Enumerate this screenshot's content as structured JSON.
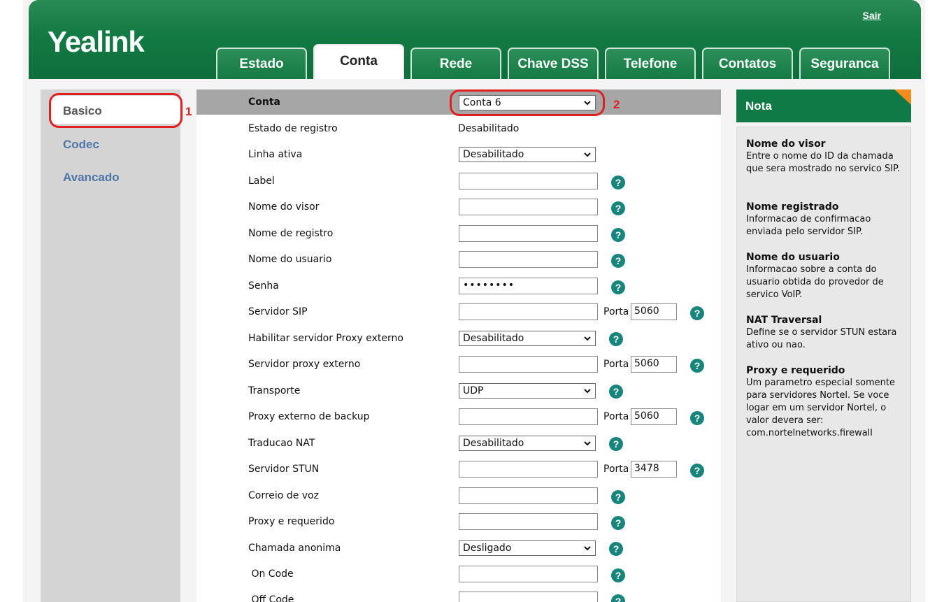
{
  "header": {
    "logo": "Yealink",
    "logout": "Sair",
    "tabs": [
      "Estado",
      "Conta",
      "Rede",
      "Chave DSS",
      "Telefone",
      "Contatos",
      "Seguranca"
    ],
    "active_tab": "Conta"
  },
  "sidebar": {
    "items": [
      "Basico",
      "Codec",
      "Avancado"
    ],
    "active": "Basico"
  },
  "annotations": [
    "1",
    "2"
  ],
  "form": {
    "account_label": "Conta",
    "account_value": "Conta 6",
    "rows": [
      {
        "label": "Estado de registro",
        "value": "Desabilitado"
      },
      {
        "label": "Linha ativa",
        "value": "Desabilitado"
      },
      {
        "label": "Label",
        "value": ""
      },
      {
        "label": "Nome do visor",
        "value": ""
      },
      {
        "label": "Nome de registro",
        "value": ""
      },
      {
        "label": "Nome do usuario",
        "value": ""
      },
      {
        "label": "Senha",
        "value": "••••••••"
      },
      {
        "label": "Servidor SIP",
        "value": "",
        "porta": "5060"
      },
      {
        "label": "Habilitar servidor Proxy externo",
        "value": "Desabilitado"
      },
      {
        "label": "Servidor proxy externo",
        "value": "",
        "porta": "5060"
      },
      {
        "label": "Transporte",
        "value": "UDP"
      },
      {
        "label": "Proxy externo de backup",
        "value": "",
        "porta": "5060"
      },
      {
        "label": "Traducao NAT",
        "value": "Desabilitado"
      },
      {
        "label": "Servidor STUN",
        "value": "",
        "porta": "3478"
      },
      {
        "label": "Correio de voz",
        "value": ""
      },
      {
        "label": "Proxy e requerido",
        "value": ""
      },
      {
        "label": "Chamada anonima",
        "value": "Desligado"
      },
      {
        "label": " On Code",
        "value": ""
      },
      {
        "label": " Off Code",
        "value": ""
      }
    ],
    "porta_label": "Porta",
    "help_glyph": "?"
  },
  "note": {
    "title": "Nota",
    "sections": [
      {
        "title": "Nome do visor",
        "text": "Entre o nome do ID da chamada que sera mostrado no servico SIP."
      },
      {
        "title": "Nome registrado",
        "text": "Informacao de confirmacao enviada pelo servidor SIP."
      },
      {
        "title": "Nome do usuario",
        "text": "Informacao sobre a conta do usuario obtida do provedor de servico VoIP."
      },
      {
        "title": "NAT Traversal",
        "text": "Define se o servidor STUN estara ativo ou nao."
      },
      {
        "title": "Proxy e requerido",
        "text": "Um parametro especial somente para servidores Nortel. Se voce logar em um servidor Nortel, o valor devera ser: com.nortelnetworks.firewall"
      }
    ]
  },
  "colors": {
    "brand_green": "#0f7a45",
    "help_teal": "#17857c",
    "annotation_red": "#e02020",
    "note_accent": "#f28c1e"
  }
}
